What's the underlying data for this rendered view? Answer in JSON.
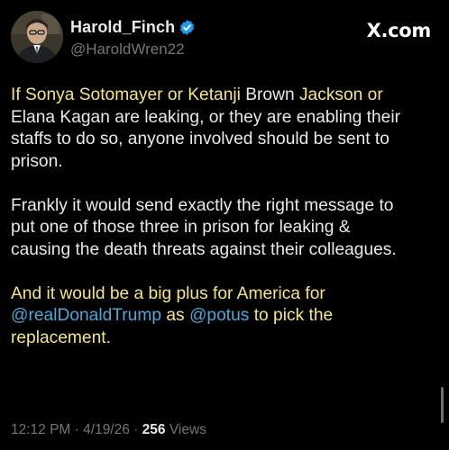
{
  "author": {
    "display_name": "Harold_Finch",
    "handle": "@HaroldWren22",
    "verified": true
  },
  "brand": "X.com",
  "colors": {
    "text": "#e7e9ea",
    "secondary": "#71767b",
    "highlight": "#f3e48a",
    "mention": "#4da8d9",
    "verified_badge": "#1d9bf0"
  },
  "post": {
    "p1": {
      "s1": "If Sonya Sotomayer or Ketanji ",
      "s2": "Brown",
      "s3": " Jackson or",
      "s4": "Elana Kagan are leaking, or they are enabling their",
      "s5": "staffs to do so, anyone involved should be sent to",
      "s6": "prison."
    },
    "p2": {
      "l1": "Frankly it would send exactly the right message to",
      "l2": "put one of those three in prison for leaking &",
      "l3": "causing the death threats against their colleagues."
    },
    "p3": {
      "l1": "And it would be a big plus for America for",
      "mention1": "@realDonaldTrump",
      "as": " as ",
      "mention2": "@potus",
      "end": " to pick the",
      "l3": "replacement."
    }
  },
  "meta": {
    "time": "12:12 PM",
    "sep1": " · ",
    "date": "4/19/26",
    "sep2": " · ",
    "views_count": "256",
    "views_label": " Views"
  }
}
